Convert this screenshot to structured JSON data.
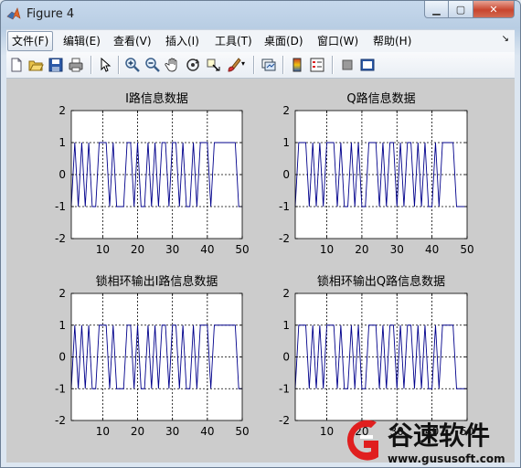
{
  "window": {
    "title": "Figure 4",
    "buttons": {
      "minimize": "minimize-icon",
      "maximize": "maximize-icon",
      "close": "close-icon"
    }
  },
  "menu": {
    "items": [
      {
        "label": "文件(F)",
        "active": true
      },
      {
        "label": "编辑(E)"
      },
      {
        "label": "查看(V)"
      },
      {
        "label": "插入(I)"
      },
      {
        "label": "工具(T)"
      },
      {
        "label": "桌面(D)"
      },
      {
        "label": "窗口(W)"
      },
      {
        "label": "帮助(H)"
      }
    ],
    "overflow_glyph": "↘"
  },
  "toolbar": {
    "icons": [
      "new-figure-icon",
      "open-file-icon",
      "save-icon",
      "print-icon",
      "edit-plot-arrow-icon",
      "zoom-in-icon",
      "zoom-out-icon",
      "pan-hand-icon",
      "rotate-3d-icon",
      "data-cursor-icon",
      "brush-icon",
      "brush-dropdown-icon",
      "link-plot-icon",
      "colorbar-icon",
      "legend-icon",
      "hide-plot-tools-icon",
      "show-plot-tools-icon"
    ]
  },
  "colors": {
    "line": "#00008b",
    "figure_bg": "#cccccc",
    "axes_bg": "#ffffff"
  },
  "chart_data": [
    {
      "type": "line",
      "title": "I路信息数据",
      "xlim": [
        1,
        50
      ],
      "ylim": [
        -2,
        2
      ],
      "xticks": [
        10,
        20,
        30,
        40,
        50
      ],
      "yticks": [
        -2,
        -1,
        0,
        1,
        2
      ],
      "grid": true,
      "series": [
        {
          "values": [
            -1,
            1,
            -1,
            1,
            -1,
            1,
            -1,
            -1,
            1,
            1,
            1,
            -1,
            1,
            -1,
            -1,
            -1,
            1,
            1,
            -1,
            1,
            -1,
            -1,
            1,
            -1,
            1,
            -1,
            1,
            1,
            -1,
            1,
            1,
            -1,
            1,
            -1,
            -1,
            1,
            -1,
            1,
            1,
            1,
            -1,
            1,
            1,
            1,
            1,
            1,
            1,
            1,
            -1,
            -1
          ]
        }
      ]
    },
    {
      "type": "line",
      "title": "Q路信息数据",
      "xlim": [
        1,
        50
      ],
      "ylim": [
        -2,
        2
      ],
      "xticks": [
        10,
        20,
        30,
        40,
        50
      ],
      "yticks": [
        -2,
        -1,
        0,
        1,
        2
      ],
      "grid": true,
      "series": [
        {
          "values": [
            -1,
            1,
            1,
            1,
            -1,
            1,
            -1,
            1,
            -1,
            1,
            1,
            1,
            -1,
            1,
            -1,
            -1,
            1,
            -1,
            1,
            -1,
            -1,
            1,
            1,
            1,
            -1,
            1,
            -1,
            1,
            1,
            -1,
            1,
            -1,
            1,
            1,
            -1,
            1,
            -1,
            1,
            -1,
            -1,
            1,
            -1,
            1,
            1,
            1,
            1,
            -1,
            -1,
            -1,
            -1
          ]
        }
      ]
    },
    {
      "type": "line",
      "title": "锁相环输出I路信息数据",
      "xlim": [
        1,
        50
      ],
      "ylim": [
        -2,
        2
      ],
      "xticks": [
        10,
        20,
        30,
        40,
        50
      ],
      "yticks": [
        -2,
        -1,
        0,
        1,
        2
      ],
      "grid": true,
      "series": [
        {
          "values": [
            -1,
            1,
            -1,
            1,
            -1,
            1,
            -1,
            -1,
            1,
            1,
            1,
            -1,
            1,
            -1,
            -1,
            -1,
            1,
            1,
            -1,
            1,
            -1,
            -1,
            1,
            -1,
            1,
            -1,
            1,
            1,
            -1,
            1,
            1,
            -1,
            1,
            -1,
            -1,
            1,
            -1,
            1,
            1,
            1,
            -1,
            1,
            1,
            1,
            1,
            1,
            1,
            1,
            -1,
            -1
          ]
        }
      ]
    },
    {
      "type": "line",
      "title": "锁相环输出Q路信息数据",
      "xlim": [
        1,
        50
      ],
      "ylim": [
        -2,
        2
      ],
      "xticks": [
        10,
        20,
        30,
        40,
        50
      ],
      "yticks": [
        -2,
        -1,
        0,
        1,
        2
      ],
      "grid": true,
      "series": [
        {
          "values": [
            -1,
            1,
            1,
            1,
            -1,
            1,
            -1,
            1,
            -1,
            1,
            1,
            1,
            -1,
            1,
            -1,
            -1,
            1,
            -1,
            1,
            -1,
            -1,
            1,
            1,
            1,
            -1,
            1,
            -1,
            1,
            1,
            -1,
            1,
            -1,
            1,
            1,
            -1,
            1,
            -1,
            1,
            -1,
            -1,
            1,
            -1,
            1,
            1,
            1,
            1,
            -1,
            -1,
            -1,
            -1
          ]
        }
      ]
    }
  ],
  "watermark": {
    "brand": "谷速软件",
    "url": "www.gususoft.com",
    "logo": "gususoft-logo-icon"
  }
}
